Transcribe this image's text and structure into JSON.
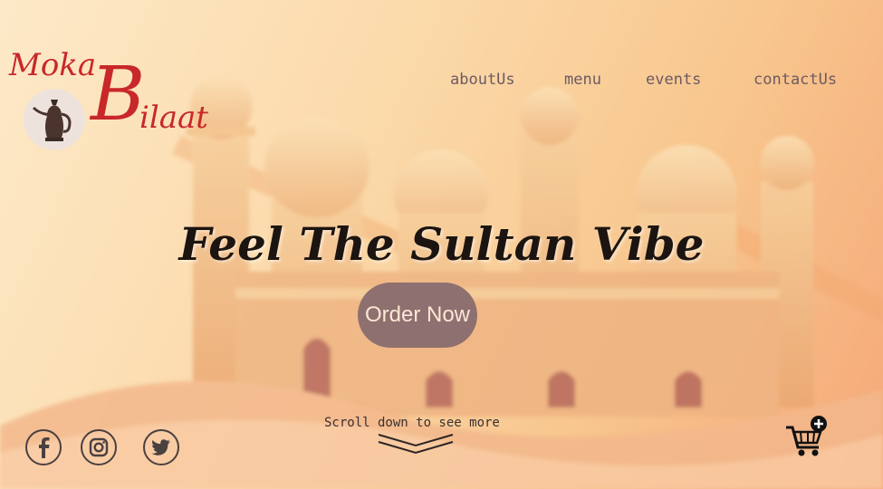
{
  "brand": {
    "name_line1": "Moka",
    "name_initial": "B",
    "name_rest": "ilaat",
    "color": "#c8282a",
    "emblem_icon": "dallah-coffee-pot-icon"
  },
  "nav": {
    "items": [
      {
        "label": "aboutUs"
      },
      {
        "label": "menu"
      },
      {
        "label": "events"
      },
      {
        "label": "contactUs"
      }
    ]
  },
  "hero": {
    "headline": "Feel The Sultan Vibe",
    "cta_label": "Order Now"
  },
  "scroll": {
    "hint": "Scroll down to see more",
    "icon": "double-chevron-down-icon"
  },
  "social": [
    {
      "icon": "facebook-icon"
    },
    {
      "icon": "instagram-icon"
    },
    {
      "icon": "twitter-icon"
    }
  ],
  "cart": {
    "icon": "cart-add-icon"
  },
  "colors": {
    "accent": "#c8282a",
    "nav_text": "#6d5a62",
    "cta_bg": "#8f7070",
    "cta_text": "#fbe7d4"
  }
}
